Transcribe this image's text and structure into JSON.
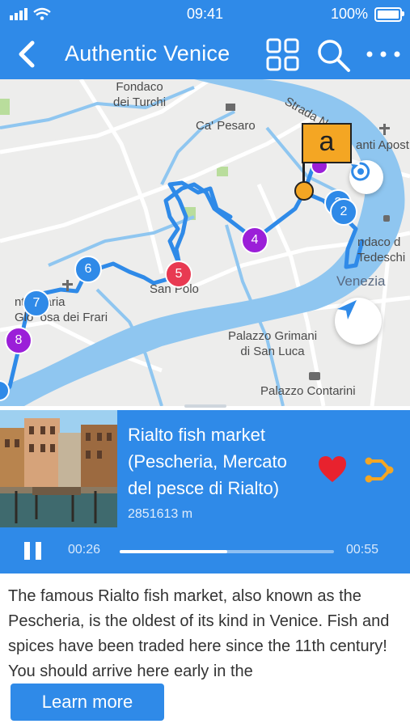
{
  "status_bar": {
    "time": "09:41",
    "battery": "100%"
  },
  "header": {
    "title": "Authentic Venice"
  },
  "map": {
    "labels": {
      "fondaco_turchi": "Fondaco\ndei Turchi",
      "ca_pesaro": "Ca' Pesaro",
      "strada_nova": "Strada Nova",
      "santi_apost": "anti Apost",
      "fondaco_tedeschi": "ndaco d\nTedeschi",
      "venezia": "Venezia",
      "san_polo": "San Polo",
      "frari": "nta Maria\nGlo  osa dei Frari",
      "palazzo_grimani": "Palazzo Grimani\ndi San Luca",
      "palazzo_contarini": "Palazzo Contarini"
    },
    "markers": [
      "2",
      "3",
      "4",
      "5",
      "6",
      "7",
      "8"
    ],
    "flag_label": "a"
  },
  "poi": {
    "title": "Rialto fish market (Pescheria, Mercato del pesce di Rialto)",
    "distance": "2851613 m"
  },
  "player": {
    "elapsed": "00:26",
    "total": "00:55",
    "progress": 0.5
  },
  "description": "The famous Rialto fish market, also known as the Pescheria, is the oldest of its kind in Venice. Fish and spices have been traded here since the 11th century! You should arrive here early in the",
  "learn_more": "Learn more",
  "colors": {
    "primary": "#2f8ae8",
    "route": "#2f8ae8",
    "flag": "#f4a623",
    "heart": "#e8222e"
  }
}
